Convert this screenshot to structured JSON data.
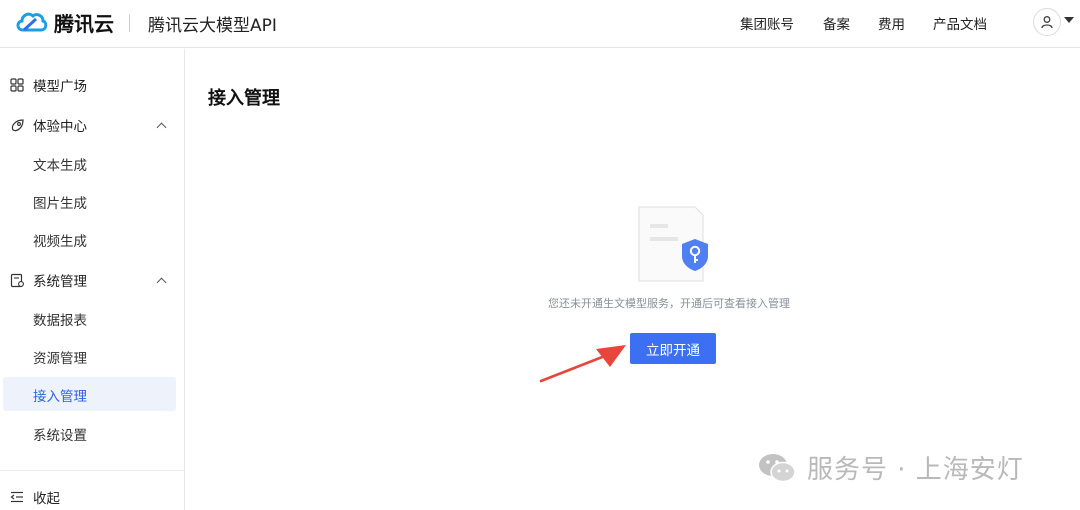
{
  "header": {
    "brand": "腾讯云",
    "product": "腾讯云大模型API",
    "nav": [
      "集团账号",
      "备案",
      "费用",
      "产品文档"
    ]
  },
  "sidebar": {
    "items": [
      {
        "label": "模型广场",
        "icon": "grid-icon"
      },
      {
        "label": "体验中心",
        "icon": "rocket-icon",
        "expanded": true,
        "children": [
          "文本生成",
          "图片生成",
          "视频生成"
        ]
      },
      {
        "label": "系统管理",
        "icon": "settings-doc-icon",
        "expanded": true,
        "children": [
          "数据报表",
          "资源管理",
          "接入管理",
          "系统设置"
        ]
      }
    ],
    "active": "接入管理",
    "collapse_label": "收起"
  },
  "main": {
    "title": "接入管理",
    "empty_text": "您还未开通生文模型服务，开通后可查看接入管理",
    "open_button": "立即开通"
  },
  "watermark": "服务号 · 上海安灯",
  "colors": {
    "accent": "#3d6ff2",
    "active_bg": "#eef2fb",
    "active_text": "#2b63e6",
    "arrow": "#e8453c"
  }
}
